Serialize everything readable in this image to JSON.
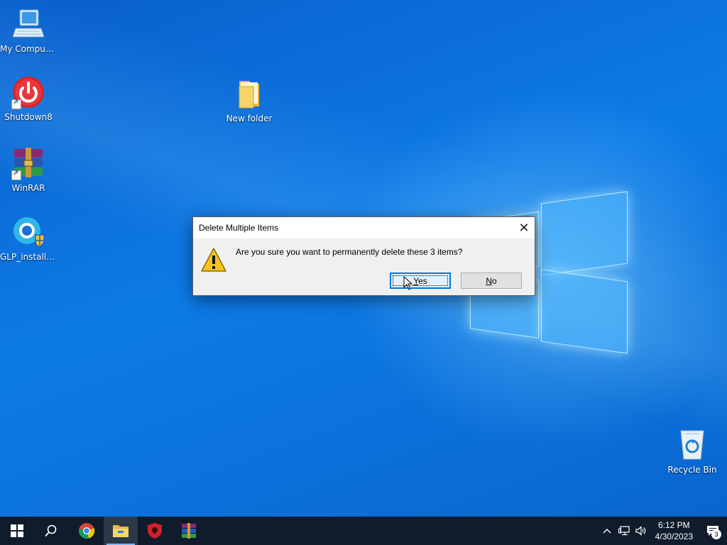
{
  "desktop": {
    "icons": [
      {
        "label": "My Computer"
      },
      {
        "label": "Shutdown8"
      },
      {
        "label": "WinRAR"
      },
      {
        "label": "GLP_installe..."
      },
      {
        "label": "New folder"
      },
      {
        "label": "Recycle Bin"
      }
    ]
  },
  "dialog": {
    "title": "Delete Multiple Items",
    "message": "Are you sure you want to permanently delete these 3 items?",
    "yes_label": "Yes",
    "no_label": "No",
    "close_glyph": "✕",
    "icon": "warning-icon"
  },
  "taskbar": {
    "apps": [
      "windows-start-icon",
      "search-icon",
      "chrome-icon",
      "file-explorer-icon",
      "shield-app-icon",
      "winrar-icon"
    ],
    "active_app": "file-explorer-icon",
    "clock_time": "6:12 PM",
    "clock_date": "4/30/2023",
    "notification_count": "3"
  },
  "colors": {
    "accent": "#0078d7",
    "taskbar": "#101c2c",
    "desktop": "#0b6fd8"
  }
}
